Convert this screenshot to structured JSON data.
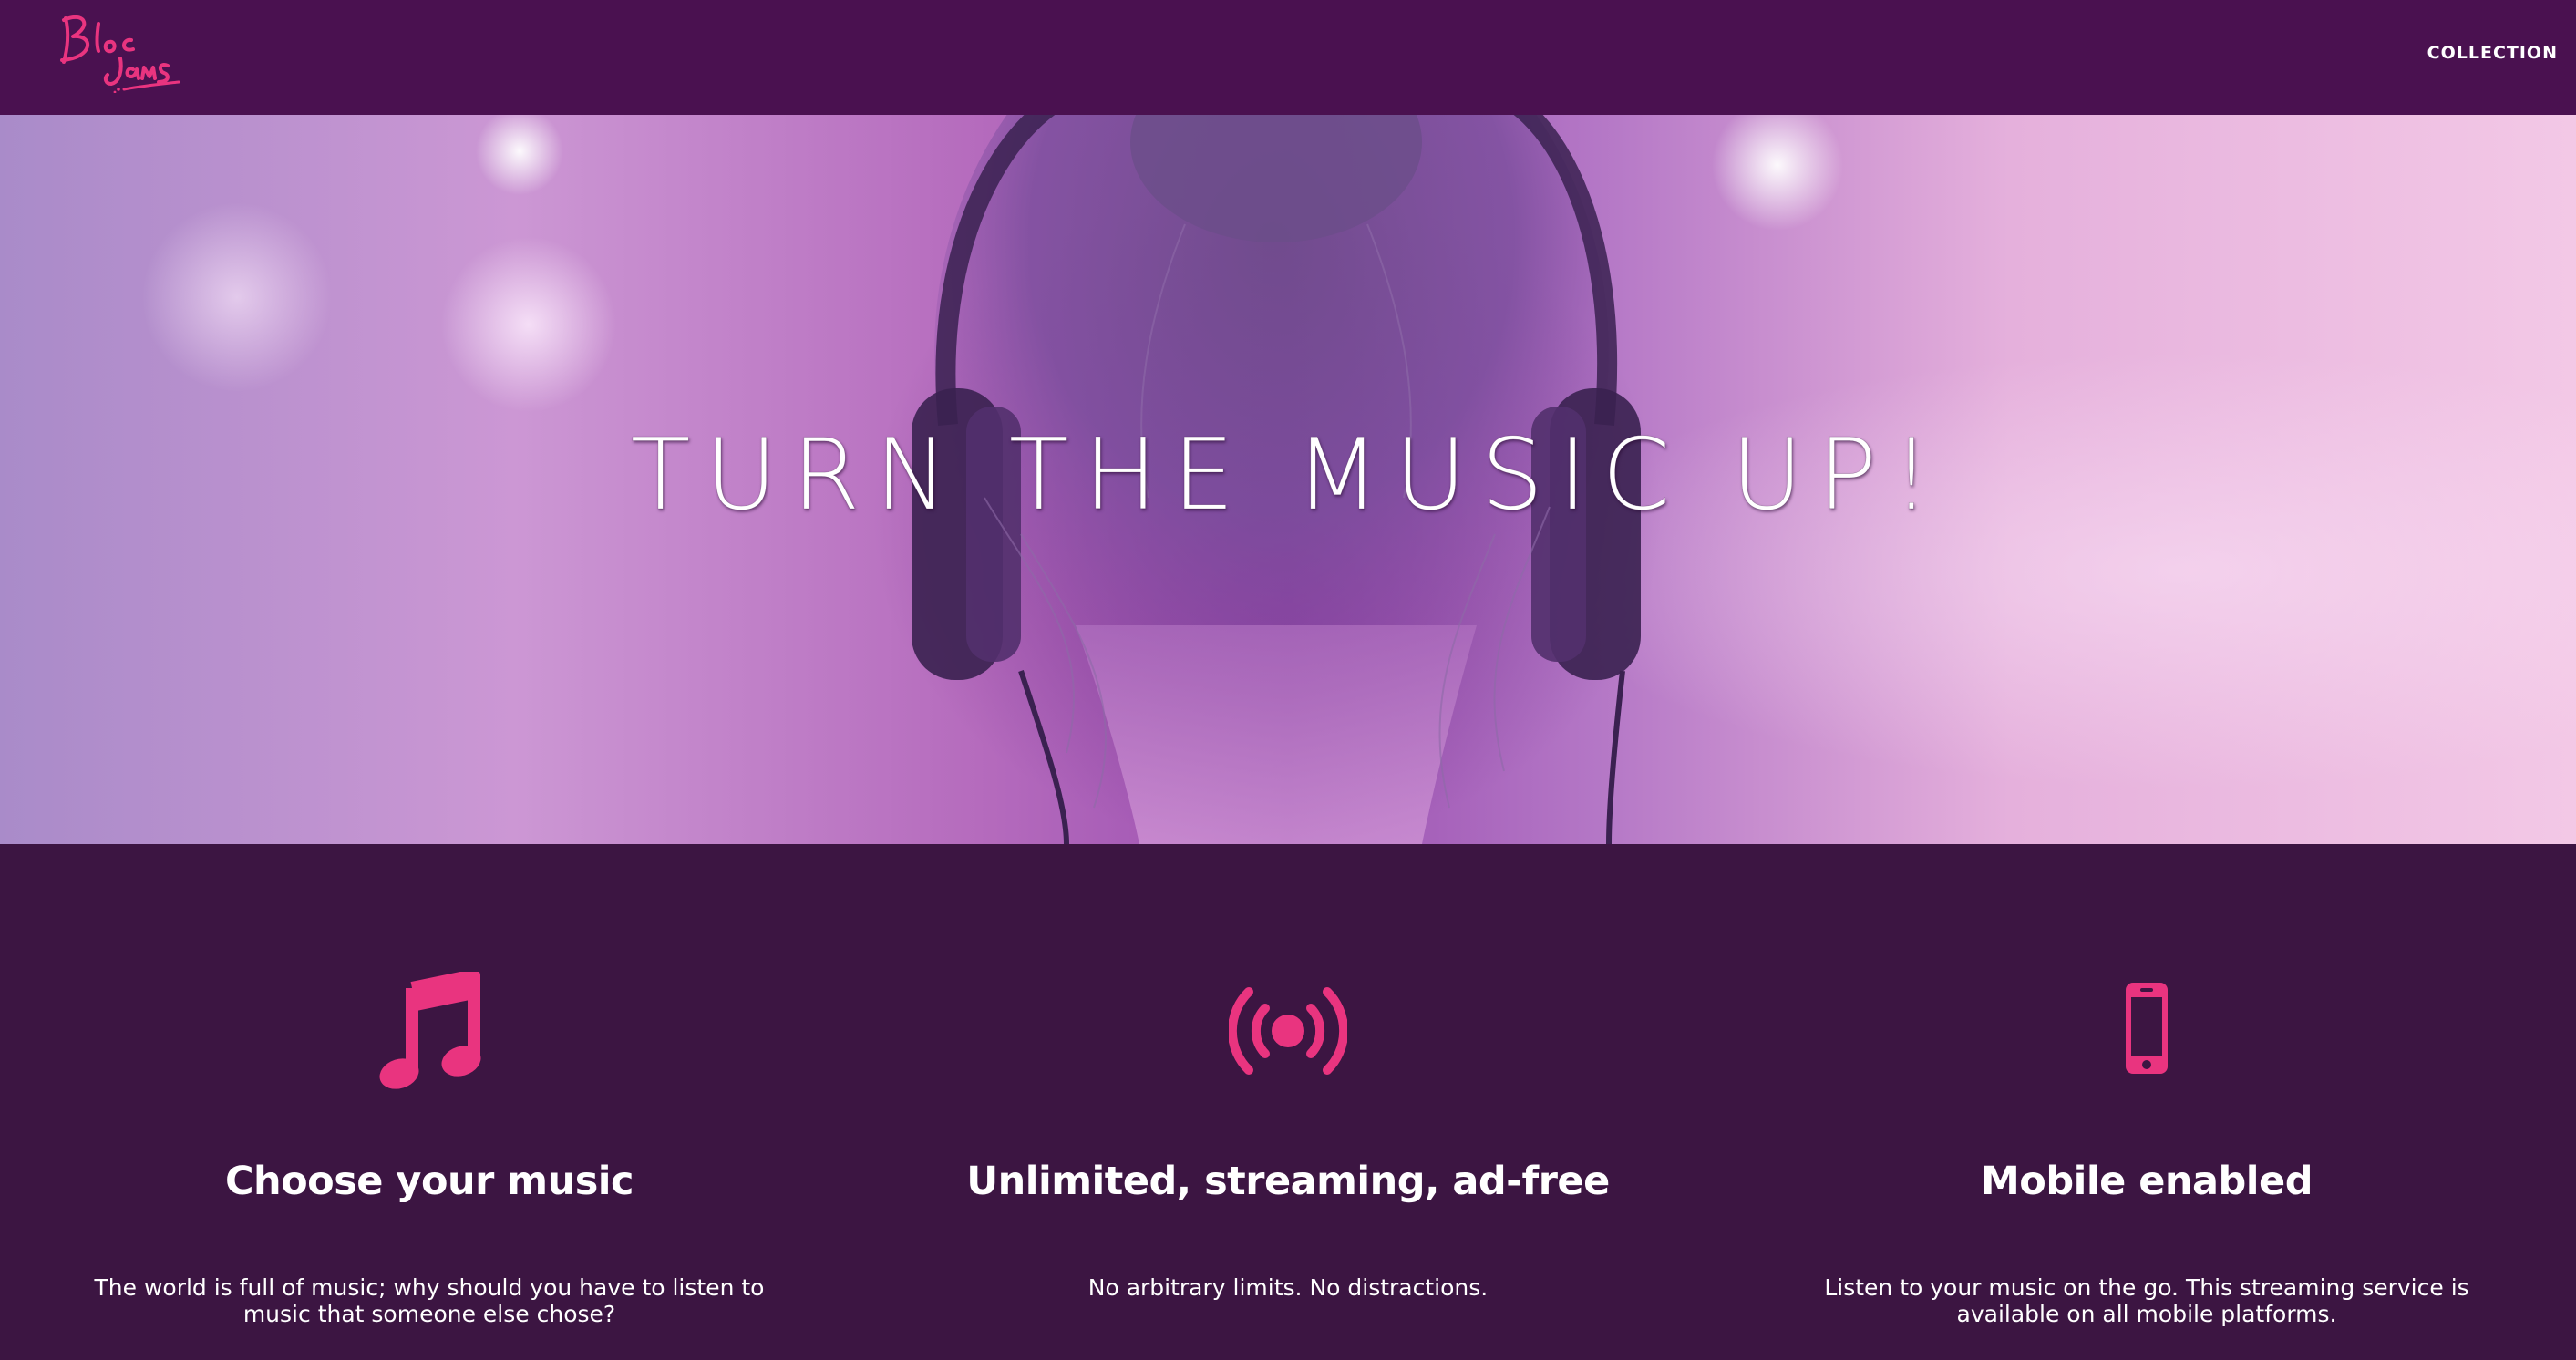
{
  "navbar": {
    "logo_alt": "Bloc Jams",
    "links": [
      {
        "label": "COLLECTION"
      }
    ]
  },
  "hero": {
    "title": "TURN THE MUSIC UP!"
  },
  "features": [
    {
      "icon": "music-note-icon",
      "title": "Choose your music",
      "text": "The world is full of music; why should you have to listen to music that someone else chose?"
    },
    {
      "icon": "broadcast-icon",
      "title": "Unlimited, streaming, ad-free",
      "text": "No arbitrary limits. No distractions."
    },
    {
      "icon": "mobile-phone-icon",
      "title": "Mobile enabled",
      "text": "Listen to your music on the go. This streaming service is available on all mobile platforms."
    }
  ],
  "colors": {
    "navbar_bg": "#4a1150",
    "features_bg": "#3c1542",
    "accent_pink": "#e9347f",
    "text": "#ffffff"
  }
}
